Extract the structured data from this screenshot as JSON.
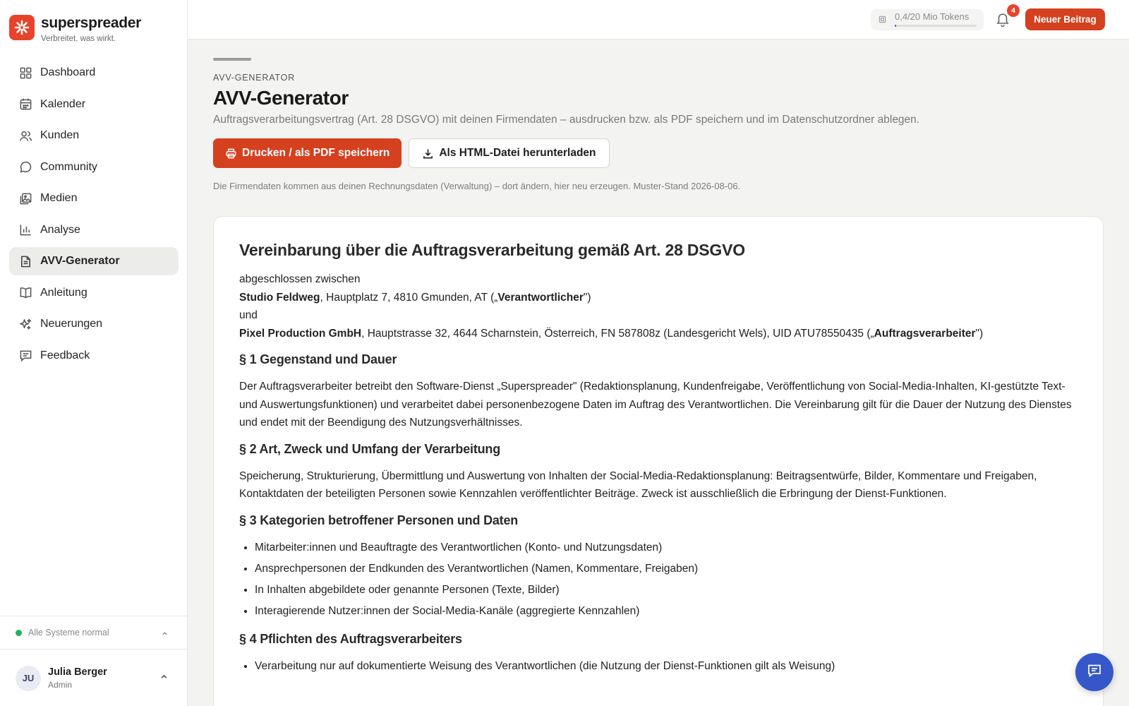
{
  "brand": {
    "name": "superspreader",
    "tagline": "Verbreitet, was wirkt."
  },
  "nav": [
    {
      "label": "Dashboard",
      "icon": "grid-icon",
      "active": false
    },
    {
      "label": "Kalender",
      "icon": "calendar-icon",
      "active": false
    },
    {
      "label": "Kunden",
      "icon": "users-icon",
      "active": false
    },
    {
      "label": "Community",
      "icon": "chat-bubble-icon",
      "active": false
    },
    {
      "label": "Medien",
      "icon": "image-icon",
      "active": false
    },
    {
      "label": "Analyse",
      "icon": "bar-chart-icon",
      "active": false
    },
    {
      "label": "AVV-Generator",
      "icon": "document-icon",
      "active": true
    },
    {
      "label": "Anleitung",
      "icon": "book-icon",
      "active": false
    },
    {
      "label": "Neuerungen",
      "icon": "sparkle-icon",
      "active": false
    },
    {
      "label": "Feedback",
      "icon": "message-square-icon",
      "active": false
    }
  ],
  "status": {
    "text": "Alle Systeme normal",
    "color": "#22b35a"
  },
  "user": {
    "initials": "JU",
    "name": "Julia Berger",
    "role": "Admin"
  },
  "topbar": {
    "tokens_label": "0,4/20 Mio Tokens",
    "tokens_used_fraction": 0.02,
    "notifications_count": "4",
    "new_post_label": "Neuer Beitrag"
  },
  "page": {
    "eyebrow": "AVV-GENERATOR",
    "title": "AVV-Generator",
    "subtitle": "Auftragsverarbeitungsvertrag (Art. 28 DSGVO) mit deinen Firmendaten – ausdrucken bzw. als PDF speichern und im Datenschutzordner ablegen.",
    "print_button": "Drucken / als PDF speichern",
    "download_button": "Als HTML-Datei herunterladen",
    "note": "Die Firmendaten kommen aus deinen Rechnungsdaten (Verwaltung) – dort ändern, hier neu erzeugen. Muster-Stand 2026-08-06."
  },
  "document": {
    "title": "Vereinbarung über die Auftragsverarbeitung gemäß Art. 28 DSGVO",
    "between": "abgeschlossen zwischen",
    "party1_name": "Studio Feldweg",
    "party1_address": ", Hauptplatz 7, 4810 Gmunden, AT („",
    "party1_role": "Verantwortlicher",
    "party1_close": "\")",
    "and": "und",
    "party2_name": "Pixel Production GmbH",
    "party2_address": ", Hauptstrasse 32, 4644 Scharnstein, Österreich, FN 587808z (Landesgericht Wels), UID ATU78550435 („",
    "party2_role": "Auftragsverarbeiter",
    "party2_close": "\")",
    "sections": {
      "s1_title": "§ 1 Gegenstand und Dauer",
      "s1_text": "Der Auftragsverarbeiter betreibt den Software-Dienst „Superspreader\" (Redaktionsplanung, Kundenfreigabe, Veröffentlichung von Social-Media-Inhalten, KI-gestützte Text- und Auswertungsfunktionen) und verarbeitet dabei personenbezogene Daten im Auftrag des Verantwortlichen. Die Vereinbarung gilt für die Dauer der Nutzung des Dienstes und endet mit der Beendigung des Nutzungsverhältnisses.",
      "s2_title": "§ 2 Art, Zweck und Umfang der Verarbeitung",
      "s2_text": "Speicherung, Strukturierung, Übermittlung und Auswertung von Inhalten der Social-Media-Redaktionsplanung: Beitragsentwürfe, Bilder, Kommentare und Freigaben, Kontaktdaten der beteiligten Personen sowie Kennzahlen veröffentlichter Beiträge. Zweck ist ausschließlich die Erbringung der Dienst-Funktionen.",
      "s3_title": "§ 3 Kategorien betroffener Personen und Daten",
      "s3_items": [
        "Mitarbeiter:innen und Beauftragte des Verantwortlichen (Konto- und Nutzungsdaten)",
        "Ansprechpersonen der Endkunden des Verantwortlichen (Namen, Kommentare, Freigaben)",
        "In Inhalten abgebildete oder genannte Personen (Texte, Bilder)",
        "Interagierende Nutzer:innen der Social-Media-Kanäle (aggregierte Kennzahlen)"
      ],
      "s4_title": "§ 4 Pflichten des Auftragsverarbeiters",
      "s4_items": [
        "Verarbeitung nur auf dokumentierte Weisung des Verantwortlichen (die Nutzung der Dienst-Funktionen gilt als Weisung)"
      ]
    }
  },
  "colors": {
    "accent": "#d5401f",
    "brand": "#e8442b",
    "fab": "#3557c9",
    "token_bar": "#3b5bdb"
  },
  "fab_icon": "chat-icon"
}
